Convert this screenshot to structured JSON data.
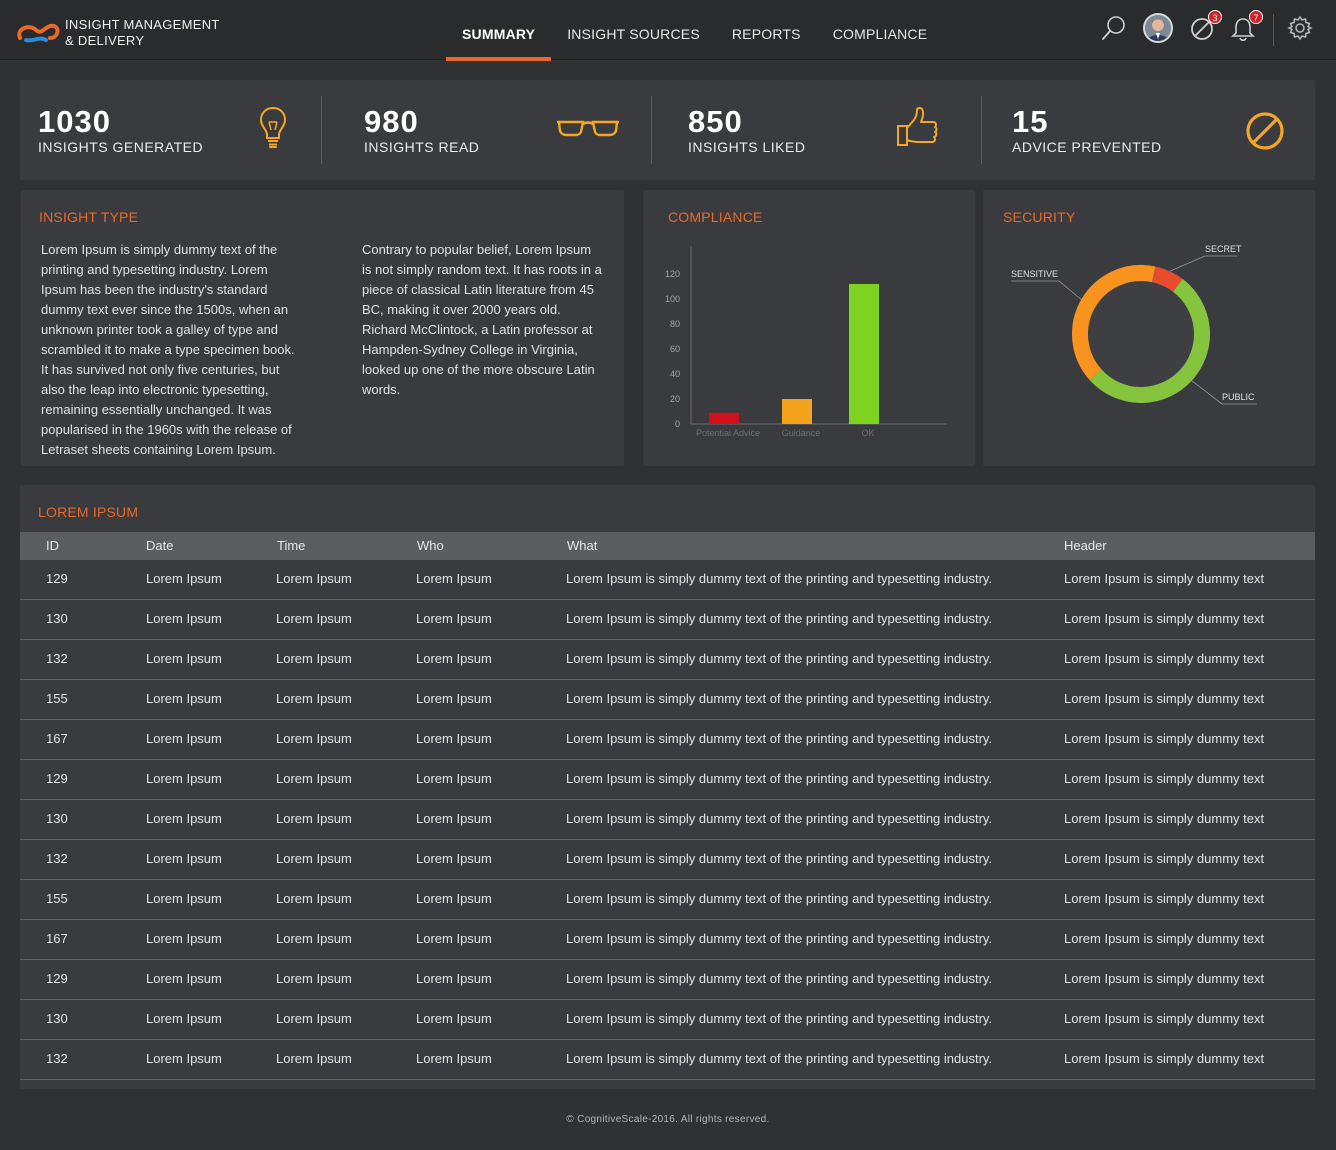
{
  "app": {
    "brand_line1": "INSIGHT MANAGEMENT",
    "brand_line2": "& DELIVERY",
    "accent_color": "#e8692a"
  },
  "nav": {
    "items": [
      {
        "label": "SUMMARY",
        "active": true
      },
      {
        "label": "INSIGHT SOURCES",
        "active": false
      },
      {
        "label": "REPORTS",
        "active": false
      },
      {
        "label": "COMPLIANCE",
        "active": false
      }
    ]
  },
  "header_icons": {
    "search": "search-icon",
    "block_badge": "3",
    "bell_badge": "7",
    "settings": "gear-icon"
  },
  "stats": [
    {
      "value": "1030",
      "label": "INSIGHTS GENERATED",
      "icon": "lightbulb-icon"
    },
    {
      "value": "980",
      "label": "INSIGHTS READ",
      "icon": "glasses-icon"
    },
    {
      "value": "850",
      "label": "INSIGHTS LIKED",
      "icon": "thumbs-up-icon"
    },
    {
      "value": "15",
      "label": "ADVICE PREVENTED",
      "icon": "prohibited-icon"
    }
  ],
  "insight_type": {
    "title": "INSIGHT TYPE",
    "col1": "Lorem Ipsum is simply dummy text of the printing and typesetting industry. Lorem Ipsum has been the industry's standard dummy text ever since the 1500s, when an unknown printer took a galley of type and scrambled it to make a type specimen book. It has survived not only five centuries, but also the leap into electronic typesetting, remaining essentially unchanged. It was popularised in the 1960s with the release of Letraset sheets containing Lorem Ipsum.",
    "col2": "Contrary to popular belief, Lorem Ipsum is not simply random text. It has roots in a piece of classical Latin literature from 45 BC, making it over 2000 years old. Richard McClintock, a Latin professor at Hampden-Sydney College in Virginia, looked up one of the more obscure Latin words."
  },
  "compliance": {
    "title": "COMPLIANCE"
  },
  "security": {
    "title": "SECURITY"
  },
  "chart_data": [
    {
      "type": "bar",
      "title": "COMPLIANCE",
      "categories": [
        "Potential Advice",
        "Guidance",
        "OK"
      ],
      "values": [
        9,
        20,
        112
      ],
      "colors": [
        "#d0111b",
        "#f5a21c",
        "#7ed321"
      ],
      "ylim": [
        0,
        120
      ],
      "yticks": [
        0,
        20,
        40,
        60,
        80,
        100,
        120
      ],
      "grid": false
    },
    {
      "type": "pie",
      "title": "SECURITY",
      "donut": true,
      "slices": [
        {
          "label": "SECRET",
          "value": 7,
          "color": "#e84c2e"
        },
        {
          "label": "PUBLIC",
          "value": 53,
          "color": "#86c43e"
        },
        {
          "label": "SENSITIVE",
          "value": 40,
          "color": "#f7931e"
        }
      ]
    }
  ],
  "table": {
    "title": "LOREM IPSUM",
    "columns": [
      "ID",
      "Date",
      "Time",
      "Who",
      "What",
      "Header"
    ],
    "rows": [
      [
        "129",
        "Lorem Ipsum",
        "Lorem Ipsum",
        "Lorem Ipsum",
        "Lorem Ipsum is simply dummy text of the printing and typesetting industry.",
        "Lorem Ipsum is simply dummy text"
      ],
      [
        "130",
        "Lorem Ipsum",
        "Lorem Ipsum",
        "Lorem Ipsum",
        "Lorem Ipsum is simply dummy text of the printing and typesetting industry.",
        "Lorem Ipsum is simply dummy text"
      ],
      [
        "132",
        "Lorem Ipsum",
        "Lorem Ipsum",
        "Lorem Ipsum",
        "Lorem Ipsum is simply dummy text of the printing and typesetting industry.",
        "Lorem Ipsum is simply dummy text"
      ],
      [
        "155",
        "Lorem Ipsum",
        "Lorem Ipsum",
        "Lorem Ipsum",
        "Lorem Ipsum is simply dummy text of the printing and typesetting industry.",
        "Lorem Ipsum is simply dummy text"
      ],
      [
        "167",
        "Lorem Ipsum",
        "Lorem Ipsum",
        "Lorem Ipsum",
        "Lorem Ipsum is simply dummy text of the printing and typesetting industry.",
        "Lorem Ipsum is simply dummy text"
      ],
      [
        "129",
        "Lorem Ipsum",
        "Lorem Ipsum",
        "Lorem Ipsum",
        "Lorem Ipsum is simply dummy text of the printing and typesetting industry.",
        "Lorem Ipsum is simply dummy text"
      ],
      [
        "130",
        "Lorem Ipsum",
        "Lorem Ipsum",
        "Lorem Ipsum",
        "Lorem Ipsum is simply dummy text of the printing and typesetting industry.",
        "Lorem Ipsum is simply dummy text"
      ],
      [
        "132",
        "Lorem Ipsum",
        "Lorem Ipsum",
        "Lorem Ipsum",
        "Lorem Ipsum is simply dummy text of the printing and typesetting industry.",
        "Lorem Ipsum is simply dummy text"
      ],
      [
        "155",
        "Lorem Ipsum",
        "Lorem Ipsum",
        "Lorem Ipsum",
        "Lorem Ipsum is simply dummy text of the printing and typesetting industry.",
        "Lorem Ipsum is simply dummy text"
      ],
      [
        "167",
        "Lorem Ipsum",
        "Lorem Ipsum",
        "Lorem Ipsum",
        "Lorem Ipsum is simply dummy text of the printing and typesetting industry.",
        "Lorem Ipsum is simply dummy text"
      ],
      [
        "129",
        "Lorem Ipsum",
        "Lorem Ipsum",
        "Lorem Ipsum",
        "Lorem Ipsum is simply dummy text of the printing and typesetting industry.",
        "Lorem Ipsum is simply dummy text"
      ],
      [
        "130",
        "Lorem Ipsum",
        "Lorem Ipsum",
        "Lorem Ipsum",
        "Lorem Ipsum is simply dummy text of the printing and typesetting industry.",
        "Lorem Ipsum is simply dummy text"
      ],
      [
        "132",
        "Lorem Ipsum",
        "Lorem Ipsum",
        "Lorem Ipsum",
        "Lorem Ipsum is simply dummy text of the printing and typesetting industry.",
        "Lorem Ipsum is simply dummy text"
      ]
    ]
  },
  "footer": {
    "text": "© CognitiveScale-2016. All rights reserved."
  }
}
